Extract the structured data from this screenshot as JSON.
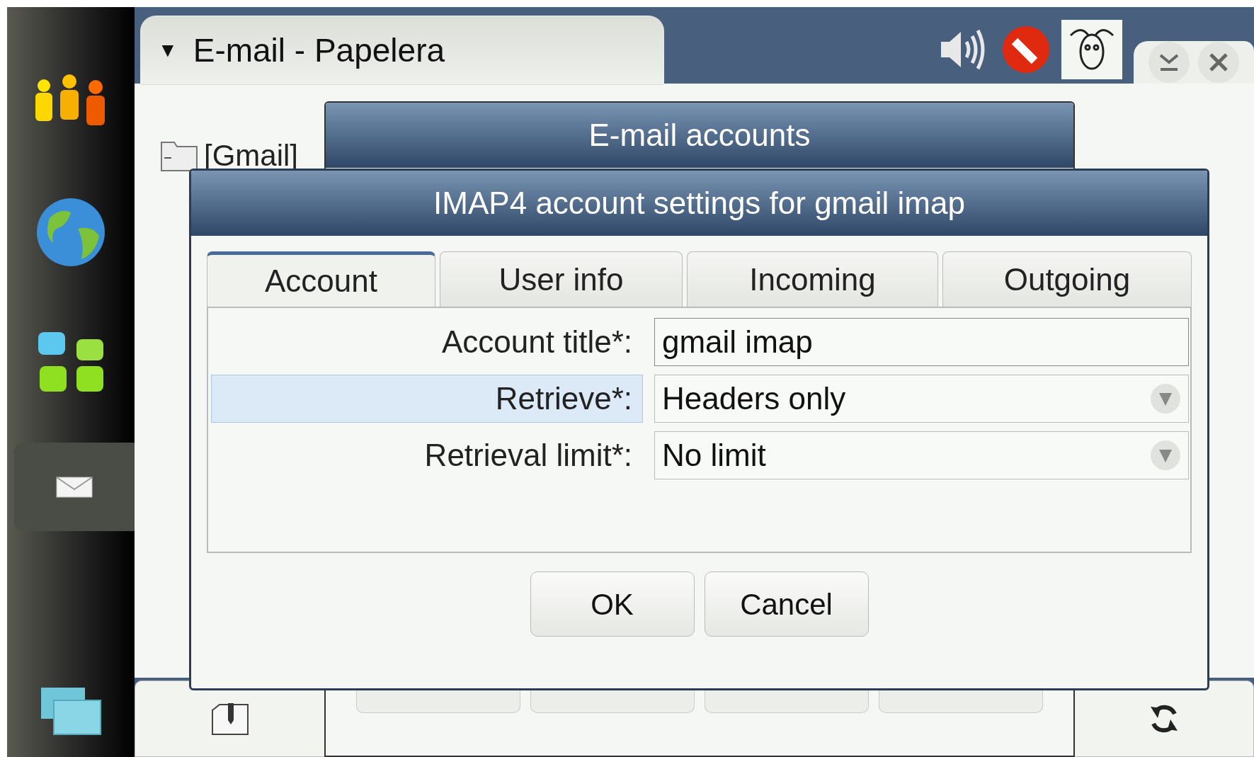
{
  "sidebar": {
    "items": [
      {
        "kind": "contacts",
        "selected": false
      },
      {
        "kind": "web",
        "selected": false
      },
      {
        "kind": "apps",
        "selected": false
      },
      {
        "kind": "mail",
        "selected": true
      },
      {
        "kind": "windows",
        "selected": false
      }
    ]
  },
  "window": {
    "title": "E-mail - Papelera",
    "menu_marker": "▼"
  },
  "folders": [
    {
      "label": "[Gmail]"
    }
  ],
  "background_dialog": {
    "title": "E-mail accounts"
  },
  "dialog": {
    "title": "IMAP4 account settings for gmail imap",
    "tabs": [
      {
        "label": "Account",
        "selected": true
      },
      {
        "label": "User info",
        "selected": false
      },
      {
        "label": "Incoming",
        "selected": false
      },
      {
        "label": "Outgoing",
        "selected": false
      }
    ],
    "fields": [
      {
        "kind": "text",
        "label": "Account title*:",
        "value": "gmail imap",
        "focused": false
      },
      {
        "kind": "dropdown",
        "label": "Retrieve*:",
        "value": "Headers only",
        "focused": true
      },
      {
        "kind": "dropdown",
        "label": "Retrieval limit*:",
        "value": "No limit",
        "focused": false
      }
    ],
    "buttons": [
      "OK",
      "Cancel"
    ]
  }
}
